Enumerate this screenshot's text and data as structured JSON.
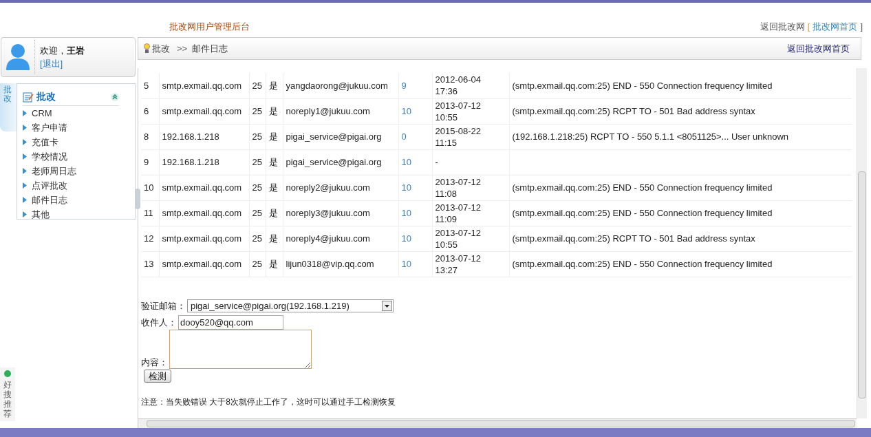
{
  "header": {
    "title": "批改网用户管理后台",
    "back_label": "返回批改网",
    "back_link": "批改网首页",
    "bracket_open": "[",
    "bracket_close": "]"
  },
  "user": {
    "welcome": "欢迎，",
    "name": "王岩",
    "logout": "[退出]"
  },
  "side_tab": "批改",
  "menu": {
    "title": "批改",
    "expanded": true,
    "items": [
      {
        "label": "CRM",
        "selected": false
      },
      {
        "label": "客户申请",
        "selected": false
      },
      {
        "label": "充值卡",
        "selected": false
      },
      {
        "label": "学校情况",
        "selected": false
      },
      {
        "label": "老师周日志",
        "selected": false
      },
      {
        "label": "点评批改",
        "selected": false
      },
      {
        "label": "邮件日志",
        "selected": false
      },
      {
        "label": "其他",
        "selected": false
      }
    ]
  },
  "breadcrumb": {
    "root": "批改",
    "sep": ">>",
    "current": "邮件日志",
    "right_link": "返回批改网首页"
  },
  "table": {
    "rows": [
      {
        "id": "5",
        "host": "smtp.exmail.qq.com",
        "port": "25",
        "flag": "是",
        "email": "yangdaorong@jukuu.com",
        "count": "9",
        "time": [
          "2012-06-04",
          "17:36"
        ],
        "message": "(smtp.exmail.qq.com:25) END - 550 Connection frequency limited"
      },
      {
        "id": "6",
        "host": "smtp.exmail.qq.com",
        "port": "25",
        "flag": "是",
        "email": "noreply1@jukuu.com",
        "count": "10",
        "time": [
          "2013-07-12",
          "10:55"
        ],
        "message": "(smtp.exmail.qq.com:25) RCPT TO - 501 Bad address syntax"
      },
      {
        "id": "8",
        "host": "192.168.1.218",
        "port": "25",
        "flag": "是",
        "email": "pigai_service@pigai.org",
        "count": "0",
        "time": [
          "2015-08-22",
          "11:15"
        ],
        "message": "(192.168.1.218:25) RCPT TO - 550 5.1.1 <8051125>... User unknown"
      },
      {
        "id": "9",
        "host": "192.168.1.218",
        "port": "25",
        "flag": "是",
        "email": "pigai_service@pigai.org",
        "count": "10",
        "time": [
          "-"
        ]
      },
      {
        "id": "10",
        "host": "smtp.exmail.qq.com",
        "port": "25",
        "flag": "是",
        "email": "noreply2@jukuu.com",
        "count": "10",
        "time": [
          "2013-07-12",
          "11:08"
        ],
        "message": "(smtp.exmail.qq.com:25) END - 550 Connection frequency limited"
      },
      {
        "id": "11",
        "host": "smtp.exmail.qq.com",
        "port": "25",
        "flag": "是",
        "email": "noreply3@jukuu.com",
        "count": "10",
        "time": [
          "2013-07-12",
          "11:09"
        ],
        "message": "(smtp.exmail.qq.com:25) END - 550 Connection frequency limited"
      },
      {
        "id": "12",
        "host": "smtp.exmail.qq.com",
        "port": "25",
        "flag": "是",
        "email": "noreply4@jukuu.com",
        "count": "10",
        "time": [
          "2013-07-12",
          "10:55"
        ],
        "message": "(smtp.exmail.qq.com:25) RCPT TO - 501 Bad address syntax"
      },
      {
        "id": "13",
        "host": "smtp.exmail.qq.com",
        "port": "25",
        "flag": "是",
        "email": "lijun0318@vip.qq.com",
        "count": "10",
        "time": [
          "2013-07-12",
          "13:27"
        ],
        "message": "(smtp.exmail.qq.com:25) END - 550 Connection frequency limited"
      }
    ]
  },
  "form": {
    "sender_label": "验证邮箱：",
    "sender_value": "pigai_service@pigai.org(192.168.1.219)",
    "to_label": "收件人：",
    "to_value": "dooy520@qq.com",
    "content_label": "内容：",
    "submit": "检测",
    "note": "注意：当失败错误 大于8次就停止工作了，这时可以通过手工检测恢复"
  },
  "widget": {
    "label": "好搜推荐"
  }
}
